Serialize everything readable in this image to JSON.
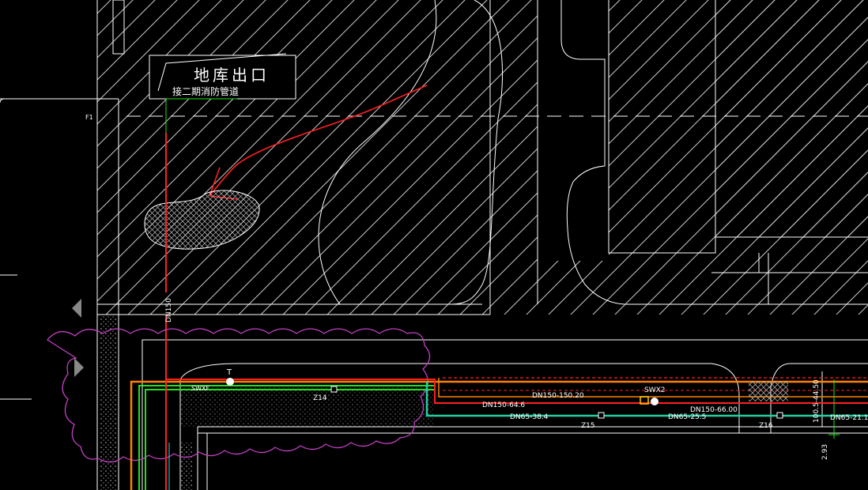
{
  "drawing": {
    "background": "#000000",
    "colors": {
      "line": "#ffffff",
      "hatch": "#c8c8c8",
      "pipe_red": "#ff2020",
      "pipe_orange": "#ff8000",
      "pipe_green": "#20e020",
      "pipe_cyan": "#20d0a0",
      "cloud": "#c040c0",
      "marker": "#ffcc00"
    },
    "title_box": {
      "title": "地库出口",
      "subtitle": "接二期消防管道"
    },
    "labels": {
      "grid_f1": "F1",
      "riser": "DN150",
      "node_a": "SWXF",
      "node_b": "SWX2",
      "zone_14": "Z14",
      "zone_15": "Z15",
      "zone_16": "Z16",
      "pipe_1": "DN150-64.6",
      "pipe_2": "DN150-150.20",
      "pipe_3": "DN65-38.4",
      "pipe_4": "DN65-25.5",
      "pipe_5": "DN150-66.00",
      "pipe_6": "DN65-21.1",
      "vert_dim": "100.5-44.50",
      "elev": "2.93",
      "tee": "T"
    },
    "nav": {
      "prev_icon": "triangle-left-icon",
      "next_icon": "triangle-right-icon"
    }
  }
}
